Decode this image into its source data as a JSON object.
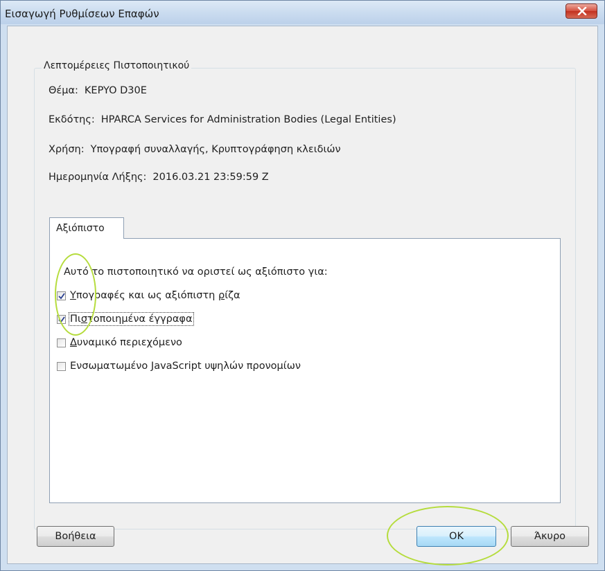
{
  "window": {
    "title": "Εισαγωγή Ρυθμίσεων Επαφών"
  },
  "details": {
    "group_title": "Λεπτομέρειες Πιστοποιητικού",
    "subject_label": "Θέμα:",
    "subject_value": "KEPYO D30E",
    "issuer_label": "Εκδότης:",
    "issuer_value": "HPARCA Services for Administration Bodies (Legal Entities)",
    "usage_label": "Χρήση:",
    "usage_value": "Υπογραφή συναλλαγής, Κρυπτογράφηση κλειδιών",
    "expiry_label": "Ημερομηνία Λήξης:",
    "expiry_value": "2016.03.21 23:59:59 Z"
  },
  "trust_tab": {
    "tab_label": "Αξιόπιστο",
    "heading": "Αυτό το πιστοποιητικό να οριστεί ως αξιόπιστο για:",
    "options": [
      {
        "label_pre": "",
        "label_u": "Υ",
        "label_post": "πογραφές και ως αξιόπιστη ",
        "label_u2": "ρ",
        "label_post2": "ίζα",
        "checked": true
      },
      {
        "label_pre": "Πι",
        "label_u": "σ",
        "label_post": "τοποιημένα έγγραφα",
        "label_u2": "",
        "label_post2": "",
        "checked": true
      },
      {
        "label_pre": "",
        "label_u": "Δ",
        "label_post": "υναμικό περιεχόμενο",
        "label_u2": "",
        "label_post2": "",
        "checked": false
      },
      {
        "label_pre": "Ενσωματωμένο ",
        "label_u": "J",
        "label_post": "avaScript υψηλών προνομίων",
        "label_u2": "",
        "label_post2": "",
        "checked": false
      }
    ]
  },
  "buttons": {
    "help": "Βοήθεια",
    "ok": "OK",
    "cancel": "Άκυρο"
  },
  "colors": {
    "highlight": "#b5dc3c",
    "close_button": "#c9412f",
    "check_mark": "#2a3f8f"
  }
}
